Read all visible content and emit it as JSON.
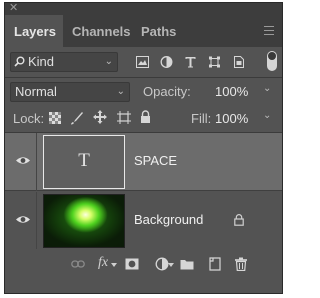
{
  "tabs": [
    {
      "label": "Layers",
      "active": true
    },
    {
      "label": "Channels",
      "active": false
    },
    {
      "label": "Paths",
      "active": false
    }
  ],
  "filter": {
    "kind_label": "Kind",
    "icons": [
      "pixel-layer-filter-icon",
      "adjustment-layer-filter-icon",
      "type-layer-filter-icon",
      "shape-layer-filter-icon",
      "smart-object-filter-icon"
    ]
  },
  "blend": {
    "mode": "Normal",
    "opacity_label": "Opacity:",
    "opacity_value": "100%"
  },
  "locks": {
    "lock_label": "Lock:",
    "fill_label": "Fill:",
    "fill_value": "100%"
  },
  "layers": [
    {
      "name": "SPACE",
      "type": "text",
      "thumb_glyph": "T",
      "selected": true,
      "visible": true,
      "locked": false
    },
    {
      "name": "Background",
      "type": "image",
      "selected": false,
      "visible": true,
      "locked": true
    }
  ],
  "bottom_icons": [
    "link-layers-icon",
    "fx-icon",
    "add-mask-icon",
    "adjustment-icon",
    "new-group-icon",
    "new-layer-icon",
    "delete-layer-icon"
  ],
  "colors": {
    "panel_bg": "#535353",
    "selected_row": "#6c6c6c",
    "tab_bar": "#3d3d3d"
  }
}
